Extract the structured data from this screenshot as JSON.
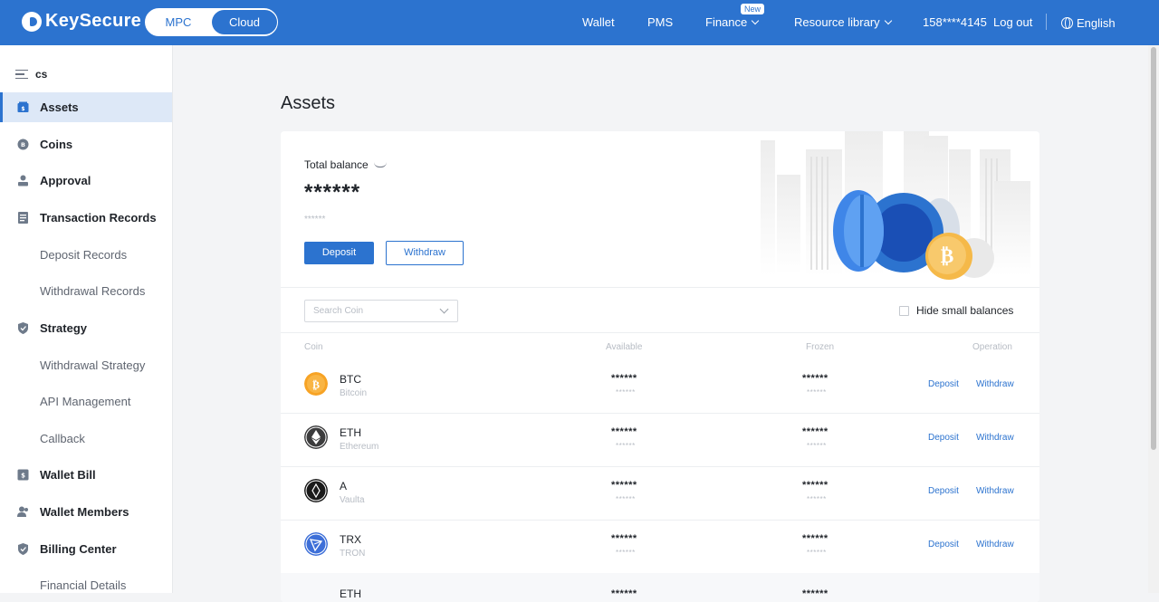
{
  "topbar": {
    "brand": "KeySecure",
    "mode_options": [
      {
        "label": "MPC"
      },
      {
        "label": "Cloud"
      }
    ],
    "nav": {
      "wallet": "Wallet",
      "pms": "PMS",
      "finance": "Finance",
      "finance_badge": "New",
      "resource": "Resource library",
      "account": "158****4145",
      "logout": "Log out",
      "language": "English"
    }
  },
  "sidebar": {
    "title": "cs",
    "items": [
      {
        "label": "Assets"
      },
      {
        "label": "Coins"
      },
      {
        "label": "Approval"
      },
      {
        "label": "Transaction Records"
      },
      {
        "label": "Deposit Records"
      },
      {
        "label": "Withdrawal Records"
      },
      {
        "label": "Strategy"
      },
      {
        "label": "Withdrawal Strategy"
      },
      {
        "label": "API Management"
      },
      {
        "label": "Callback"
      },
      {
        "label": "Wallet Bill"
      },
      {
        "label": "Wallet Members"
      },
      {
        "label": "Billing Center"
      },
      {
        "label": "Financial Details"
      }
    ]
  },
  "main": {
    "title": "Assets",
    "balance": {
      "label": "Total balance",
      "value": "******",
      "sub_value": "******",
      "deposit_label": "Deposit",
      "withdraw_label": "Withdraw"
    },
    "search": {
      "placeholder": "Search Coin"
    },
    "hide_small_label": "Hide small balances",
    "table": {
      "headers": {
        "coin": "Coin",
        "available": "Available",
        "frozen": "Frozen",
        "operation": "Operation"
      },
      "rows": [
        {
          "symbol": "BTC",
          "name": "Bitcoin",
          "available": "******",
          "available_sub": "******",
          "frozen": "******",
          "frozen_sub": "******",
          "deposit": "Deposit",
          "withdraw": "Withdraw"
        },
        {
          "symbol": "ETH",
          "name": "Ethereum",
          "available": "******",
          "available_sub": "******",
          "frozen": "******",
          "frozen_sub": "******",
          "deposit": "Deposit",
          "withdraw": "Withdraw"
        },
        {
          "symbol": "A",
          "name": "Vaulta",
          "available": "******",
          "available_sub": "******",
          "frozen": "******",
          "frozen_sub": "******",
          "deposit": "Deposit",
          "withdraw": "Withdraw"
        },
        {
          "symbol": "TRX",
          "name": "TRON",
          "available": "******",
          "available_sub": "******",
          "frozen": "******",
          "frozen_sub": "******",
          "deposit": "Deposit",
          "withdraw": "Withdraw"
        },
        {
          "symbol": "ETH",
          "name": "",
          "available": "******",
          "available_sub": "",
          "frozen": "******",
          "frozen_sub": "",
          "deposit": "",
          "withdraw": ""
        }
      ]
    }
  },
  "colors": {
    "brand": "#2c73cf",
    "active_bg": "#dde8f7",
    "btc": "#f7a325",
    "eth": "#3c3c3d",
    "vaulta": "#1a1a1a",
    "trx": "#3d6fd8"
  },
  "icons": [
    "keysecure-logo-icon",
    "chevron-down-icon",
    "globe-icon",
    "menu-icon",
    "assets-icon",
    "coins-icon",
    "approval-icon",
    "records-icon",
    "strategy-icon",
    "wallet-bill-icon",
    "members-icon",
    "billing-icon",
    "eye-closed-icon",
    "btc-icon",
    "eth-icon",
    "vaulta-icon",
    "trx-icon"
  ]
}
